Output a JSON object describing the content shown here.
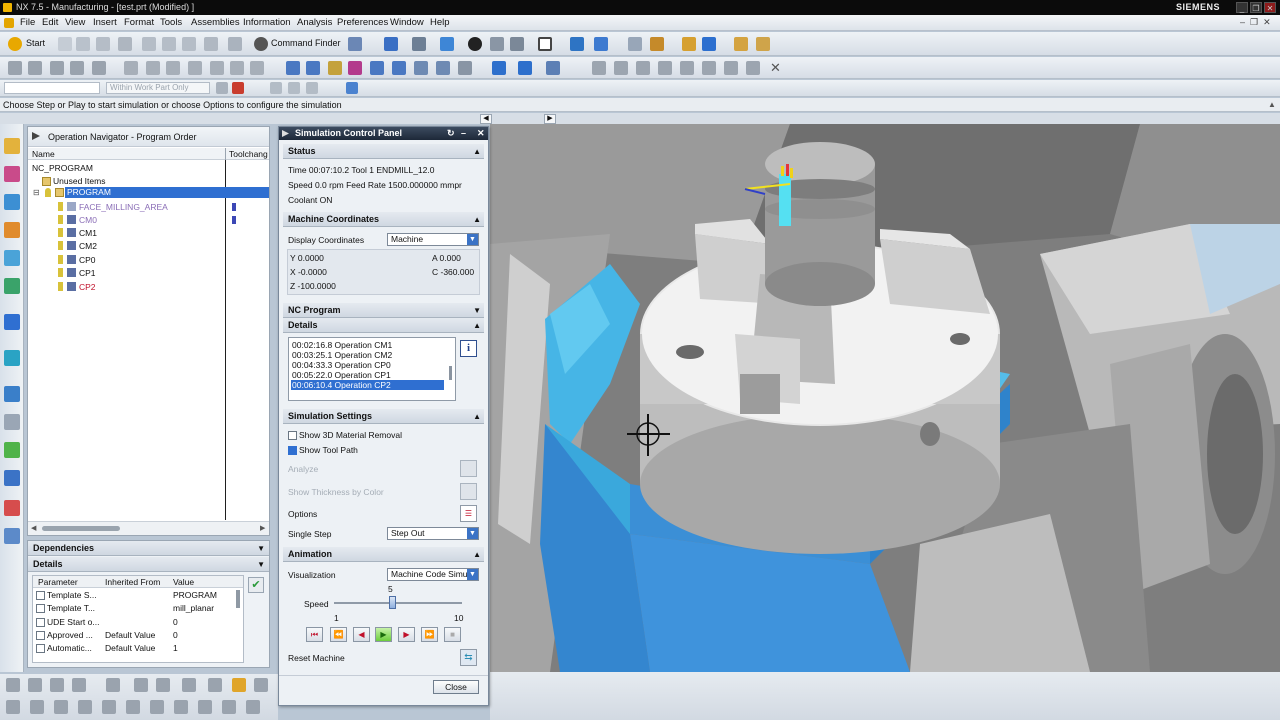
{
  "window": {
    "title": "NX 7.5 - Manufacturing - [test.prt (Modified) ]",
    "brand": "SIEMENS"
  },
  "menu": [
    "File",
    "Edit",
    "View",
    "Insert",
    "Format",
    "Tools",
    "Assemblies",
    "Information",
    "Analysis",
    "Preferences",
    "Window",
    "Help"
  ],
  "toolbar": {
    "start_label": "Start",
    "command_finder_label": "Command Finder",
    "filter_placeholder": "Within Work Part Only"
  },
  "status_line": "Choose Step or Play to start simulation or choose Options to configure the simulation",
  "navigator": {
    "title": "Operation Navigator - Program Order",
    "col_name": "Name",
    "col_tool": "Toolchang",
    "root": "NC_PROGRAM",
    "unused": "Unused Items",
    "program": "PROGRAM",
    "ops": [
      "FACE_MILLING_AREA",
      "CM0",
      "CM1",
      "CM2",
      "CP0",
      "CP1",
      "CP2"
    ]
  },
  "dependencies": {
    "title": "Dependencies"
  },
  "details_panel": {
    "title": "Details",
    "headers": [
      "Parameter",
      "Inherited From",
      "Value"
    ],
    "rows": [
      {
        "param": "Template S...",
        "from": "",
        "value": "PROGRAM"
      },
      {
        "param": "Template T...",
        "from": "",
        "value": "mill_planar"
      },
      {
        "param": "UDE Start o...",
        "from": "",
        "value": "0"
      },
      {
        "param": "Approved ...",
        "from": "Default Value",
        "value": "0"
      },
      {
        "param": "Automatic...",
        "from": "Default Value",
        "value": "1"
      }
    ]
  },
  "sim": {
    "title": "Simulation Control Panel",
    "status_hdr": "Status",
    "status_line1": "Time 00:07:10.2 Tool 1   ENDMILL_12.0",
    "status_line2": "Speed 0.0 rpm   Feed Rate 1500.000000 mmpr",
    "status_line3": "Coolant ON",
    "machine_hdr": "Machine Coordinates",
    "display_coords_label": "Display Coordinates",
    "display_coords_value": "Machine",
    "coords": {
      "y": "Y 0.0000",
      "a": "A 0.000",
      "x": "X -0.0000",
      "c": "C -360.000",
      "z": "Z -100.0000"
    },
    "nc_hdr": "NC Program",
    "details_hdr": "Details",
    "ops_list": [
      "00:02:16.8 Operation CM1",
      "00:03:25.1 Operation CM2",
      "00:04:33.3 Operation CP0",
      "00:05:22.0 Operation CP1",
      "00:06:10.4 Operation CP2"
    ],
    "settings_hdr": "Simulation Settings",
    "show3d": "Show 3D Material Removal",
    "showpath": "Show Tool Path",
    "analyze": "Analyze",
    "thickness": "Show Thickness by Color",
    "options": "Options",
    "single_step": "Single Step",
    "single_step_value": "Step Out",
    "anim_hdr": "Animation",
    "visualization": "Visualization",
    "visualization_value": "Machine Code Simu",
    "speed_label": "Speed",
    "speed_value": "5",
    "speed_min": "1",
    "speed_max": "10",
    "speed_level": 0.45,
    "reset": "Reset Machine",
    "close": "Close"
  },
  "colors": {
    "accent": "#2f6fd1",
    "cyan_part": "#46c0ea",
    "blue_table": "#3b8fd6"
  }
}
